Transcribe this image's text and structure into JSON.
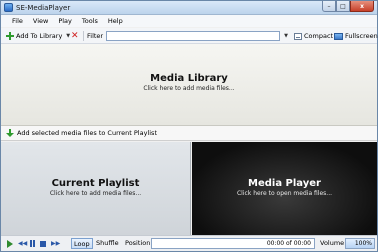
{
  "window": {
    "title": "SE-MediaPlayer",
    "minimize": "–",
    "maximize": "□",
    "close": "x"
  },
  "menu": [
    "File",
    "View",
    "Play",
    "Tools",
    "Help"
  ],
  "toolbar": {
    "add_to_library": "Add To Library",
    "filter_label": "Filter",
    "filter_value": "",
    "compact": "Compact",
    "fullscreen": "Fullscreen"
  },
  "library": {
    "title": "Media Library",
    "subtitle": "Click here to add media files..."
  },
  "add_selected": "Add selected media files to Current Playlist",
  "playlist": {
    "title": "Current Playlist",
    "subtitle": "Click here to add media files..."
  },
  "player": {
    "title": "Media Player",
    "subtitle": "Click here to open media files..."
  },
  "transport": {
    "loop": "Loop",
    "shuffle": "Shuffle",
    "position_label": "Position",
    "position_value": "00:00 of 00:00",
    "volume_label": "Volume",
    "volume_value": "100%"
  },
  "icons": [
    "app-icon",
    "add-icon",
    "remove-icon",
    "compact-icon",
    "fullscreen-icon",
    "down-arrow-icon",
    "play-icon",
    "rewind-icon",
    "pause-icon",
    "stop-icon",
    "fast-forward-icon"
  ]
}
